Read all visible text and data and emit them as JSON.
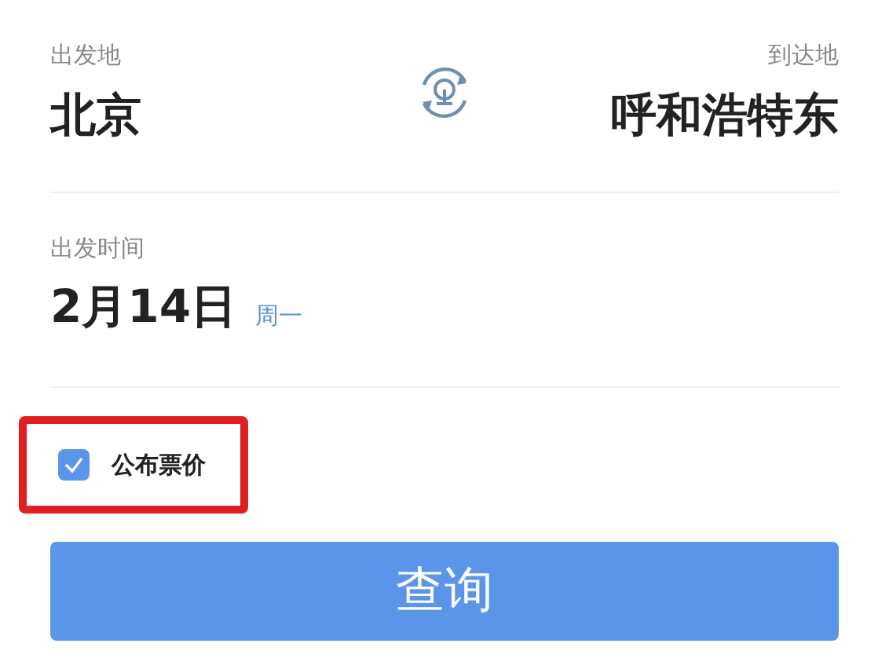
{
  "route": {
    "from_label": "出发地",
    "from_city": "北京",
    "to_label": "到达地",
    "to_city": "呼和浩特东"
  },
  "date": {
    "label": "出发时间",
    "value": "2月14日",
    "weekday": "周一"
  },
  "publish_fare": {
    "label": "公布票价",
    "checked": true,
    "highlighted": true
  },
  "search_button": {
    "label": "查询"
  }
}
